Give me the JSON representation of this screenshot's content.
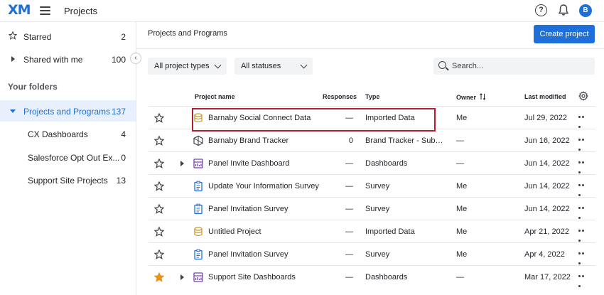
{
  "header": {
    "logo": "XM",
    "title": "Projects",
    "help_glyph": "?",
    "avatar_initial": "B"
  },
  "sidebar": {
    "starred": {
      "label": "Starred",
      "count": "2"
    },
    "shared": {
      "label": "Shared with me",
      "count": "100"
    },
    "folders_heading": "Your folders",
    "folders": [
      {
        "label": "Projects and Programs",
        "count": "137"
      },
      {
        "label": "CX Dashboards",
        "count": "4"
      },
      {
        "label": "Salesforce Opt Out Ex...",
        "count": "0"
      },
      {
        "label": "Support Site Projects",
        "count": "13"
      }
    ]
  },
  "main": {
    "breadcrumb": "Projects and Programs",
    "create_label": "Create project",
    "filters": {
      "type": "All project types",
      "status": "All statuses"
    },
    "search_placeholder": "Search...",
    "columns": {
      "name": "Project name",
      "responses": "Responses",
      "type": "Type",
      "owner": "Owner",
      "modified": "Last modified"
    },
    "rows": [
      {
        "name": "Barnaby Social Connect Data",
        "responses": "—",
        "type": "Imported Data",
        "owner": "Me",
        "modified": "Jul 29, 2022",
        "icon": "imported-data-icon",
        "starred": false,
        "expandable": false
      },
      {
        "name": "Barnaby Brand Tracker",
        "responses": "0",
        "type": "Brand Tracker - Subscri...",
        "owner": "—",
        "modified": "Jun 16, 2022",
        "icon": "brand-tracker-icon",
        "starred": false,
        "expandable": false
      },
      {
        "name": "Panel Invite Dashboard",
        "responses": "—",
        "type": "Dashboards",
        "owner": "—",
        "modified": "Jun 14, 2022",
        "icon": "dashboard-icon",
        "starred": false,
        "expandable": true
      },
      {
        "name": "Update Your Information Survey",
        "responses": "—",
        "type": "Survey",
        "owner": "Me",
        "modified": "Jun 14, 2022",
        "icon": "survey-icon",
        "starred": false,
        "expandable": false
      },
      {
        "name": "Panel Invitation Survey",
        "responses": "—",
        "type": "Survey",
        "owner": "Me",
        "modified": "Jun 14, 2022",
        "icon": "survey-icon",
        "starred": false,
        "expandable": false
      },
      {
        "name": "Untitled Project",
        "responses": "—",
        "type": "Imported Data",
        "owner": "Me",
        "modified": "Apr 21, 2022",
        "icon": "imported-data-icon",
        "starred": false,
        "expandable": false
      },
      {
        "name": "Panel Invitation Survey",
        "responses": "—",
        "type": "Survey",
        "owner": "Me",
        "modified": "Apr 4, 2022",
        "icon": "survey-icon",
        "starred": false,
        "expandable": false
      },
      {
        "name": "Support Site Dashboards",
        "responses": "—",
        "type": "Dashboards",
        "owner": "—",
        "modified": "Mar 17, 2022",
        "icon": "dashboard-icon",
        "starred": true,
        "expandable": true
      }
    ]
  },
  "colors": {
    "accent": "#1e6fd9",
    "highlight": "#b1202f",
    "star_filled": "#e8911c",
    "imported": "#c99a2e",
    "survey": "#1e6fd9",
    "dashboard": "#7b3fb6"
  }
}
